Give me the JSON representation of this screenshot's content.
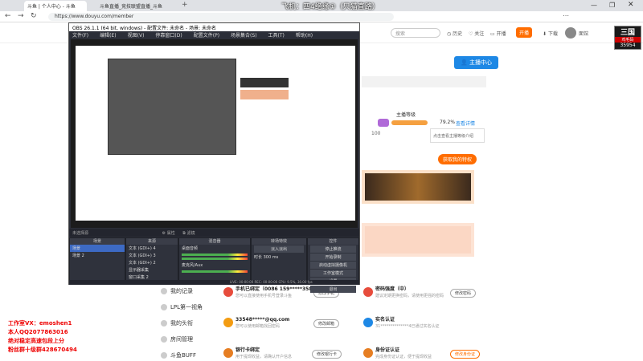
{
  "browser": {
    "tabs": [
      {
        "label": "斗鱼 | 个人中心 - 斗鱼"
      },
      {
        "label": "斗鱼直播_竞技联盟直播_斗鱼"
      }
    ],
    "url": "https://www.douyu.com/member"
  },
  "stream_overlay_title": "飞机：四4绝缘①（只猫直路）",
  "header": {
    "search_placeholder": "搜索",
    "links": [
      "历史",
      "关注",
      "开播",
      "下载"
    ],
    "open_live": "开播",
    "username": "面馆"
  },
  "badge": {
    "line1": "三国",
    "line2": "鸡毛码",
    "line3": "35954"
  },
  "right_panel": {
    "anchor_center_button": "主播中心",
    "level_title": "主播等级",
    "level_percent": "79.2%",
    "level_link": "查看详情",
    "level_next": "100",
    "bubble_text": "点击查看主播等级介绍",
    "privilege_button": "获取我的特权"
  },
  "sidebar": {
    "items": [
      "我的记录",
      "LPL第一视角",
      "我的头衔",
      "房间管理",
      "斗鱼BUFF"
    ]
  },
  "info_cards": [
    {
      "title": "手机已绑定（0086 159*****3584）",
      "sub": "您可以直接使用手机号登录斗鱼",
      "button": "修改手机"
    },
    {
      "title": "33548*****@qq.com",
      "sub": "您可以使用邮箱找回密码",
      "button": "修改邮箱"
    },
    {
      "title": "银行卡绑定",
      "sub": "用于提现收益，请确认开户信息",
      "button": "修改银行卡"
    },
    {
      "title": "密码强度（中）",
      "sub": "建议定期更换密码，请使用更强的密码",
      "button": "修改密码"
    },
    {
      "title": "实名认证",
      "sub": "31**************4已通过实名认证",
      "button": ""
    },
    {
      "title": "身份证认证",
      "sub": "完成身份证认证，便于提现收益",
      "button": "修改身份证"
    }
  ],
  "obs": {
    "title": "OBS 26.1.1 (64 bit, windows) - 配置文件: 未命名 - 场景: 未命名",
    "menu": [
      "文件(F)",
      "编辑(E)",
      "视图(V)",
      "停靠窗口(D)",
      "配置文件(P)",
      "场景集合(S)",
      "工具(T)",
      "帮助(H)"
    ],
    "source_label": "未选择源",
    "properties": "属性",
    "filters": "滤镜",
    "docks": {
      "scenes": {
        "title": "场景",
        "items": [
          "场景",
          "场景 2"
        ]
      },
      "sources": {
        "title": "来源",
        "items": [
          "文本 (GDI+) 4",
          "文本 (GDI+) 3",
          "文本 (GDI+) 2",
          "显示器采集",
          "窗口采集 2"
        ]
      },
      "mixer": {
        "title": "混音器",
        "items": [
          "桌面音频",
          "麦克风/Aux"
        ]
      },
      "transitions": {
        "title": "转场特效",
        "type": "淡入淡出",
        "duration_label": "时长",
        "duration": "300 ms"
      },
      "controls": {
        "title": "控件",
        "buttons": [
          "停止推流",
          "开始录制",
          "启动虚拟摄像机",
          "工作室模式",
          "设置",
          "退出"
        ]
      }
    },
    "status": "LIVE: 00:00:00   REC: 00:00:00   CPU: 9.5%, 30.00 fps"
  },
  "ad_text": [
    "工作室VX：emoshen1",
    "本人QQ2077863016",
    "绝对稳定高速包段上分",
    "粉丝群十级群428670494"
  ]
}
